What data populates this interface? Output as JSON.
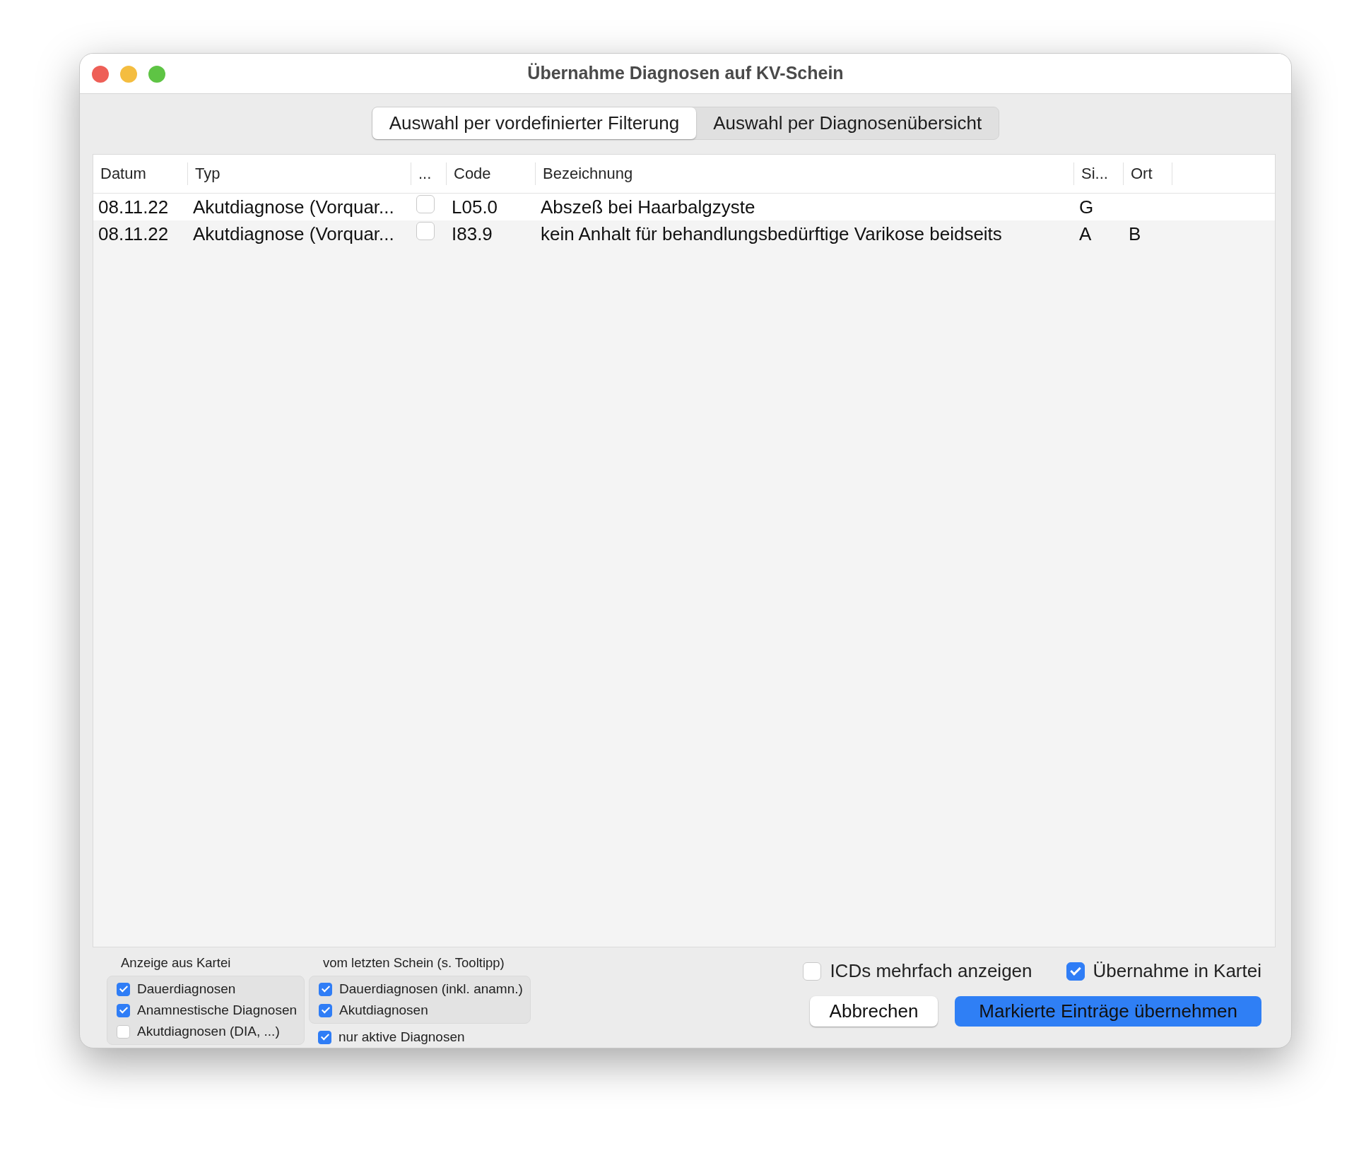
{
  "window": {
    "title": "Übernahme Diagnosen auf KV-Schein"
  },
  "tabs": [
    {
      "label": "Auswahl per vordefinierter Filterung",
      "selected": true
    },
    {
      "label": "Auswahl per Diagnosenübersicht",
      "selected": false
    }
  ],
  "table": {
    "columns": [
      "Datum",
      "Typ",
      "...",
      "Code",
      "Bezeichnung",
      "Si...",
      "Ort"
    ],
    "rows": [
      {
        "datum": "08.11.22",
        "typ": "Akutdiagnose (Vorquar...",
        "checked": false,
        "code": "L05.0",
        "bezeichnung": "Abszeß bei Haarbalgzyste",
        "si": "G",
        "ort": ""
      },
      {
        "datum": "08.11.22",
        "typ": "Akutdiagnose (Vorquar...",
        "checked": false,
        "code": "I83.9",
        "bezeichnung": "kein Anhalt für  behandlungsbedürftige Varikose beidseits",
        "si": "A",
        "ort": "B"
      }
    ]
  },
  "filter_groups": [
    {
      "title": "Anzeige aus Kartei",
      "options": [
        {
          "label": "Dauerdiagnosen",
          "checked": true
        },
        {
          "label": "Anamnestische Diagnosen",
          "checked": true
        },
        {
          "label": "Akutdiagnosen (DIA, ...)",
          "checked": false
        }
      ]
    },
    {
      "title": "vom letzten Schein (s. Tooltipp)",
      "options": [
        {
          "label": "Dauerdiagnosen (inkl. anamn.)",
          "checked": true
        },
        {
          "label": "Akutdiagnosen",
          "checked": true
        }
      ],
      "extra": [
        {
          "label": "nur aktive Diagnosen",
          "checked": true
        }
      ]
    }
  ],
  "options": [
    {
      "label": "ICDs mehrfach anzeigen",
      "checked": false
    },
    {
      "label": "Übernahme in Kartei",
      "checked": true
    }
  ],
  "buttons": [
    {
      "label": "Abbrechen",
      "primary": false
    },
    {
      "label": "Markierte Einträge übernehmen",
      "primary": true
    }
  ]
}
